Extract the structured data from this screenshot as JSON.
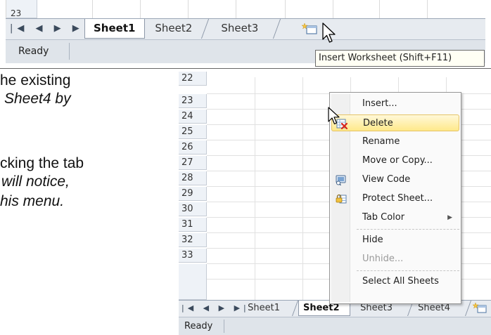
{
  "top_screenshot": {
    "row_number": "23",
    "nav_buttons": "|◀ ◀ ▶ ▶|",
    "tabs": [
      {
        "label": "Sheet1",
        "active": true
      },
      {
        "label": "Sheet2",
        "active": false
      },
      {
        "label": "Sheet3",
        "active": false
      }
    ],
    "insert_sheet_icon": "insert-worksheet-icon",
    "status": "Ready",
    "tooltip": "Insert Worksheet (Shift+F11)"
  },
  "body_text": {
    "line1": "he existing",
    "line2": "Sheet4 by",
    "line3": "cking the tab",
    "line4": "will notice,",
    "line5": "his menu."
  },
  "bottom_screenshot": {
    "row_numbers": [
      "22",
      "23",
      "24",
      "25",
      "26",
      "27",
      "28",
      "29",
      "30",
      "31",
      "32",
      "33"
    ],
    "nav_buttons": "|◀ ◀ ▶ ▶|",
    "tabs": [
      {
        "label": "Sheet1",
        "active": false
      },
      {
        "label": "Sheet2",
        "active": true
      },
      {
        "label": "Sheet3",
        "active": false
      },
      {
        "label": "Sheet4",
        "active": false
      }
    ],
    "status": "Ready",
    "context_menu": {
      "items": [
        {
          "label": "Insert...",
          "icon": "",
          "state": "normal"
        },
        {
          "label": "Delete",
          "icon": "delete-sheet-icon",
          "state": "hover"
        },
        {
          "label": "Rename",
          "icon": "",
          "state": "normal"
        },
        {
          "label": "Move or Copy...",
          "icon": "",
          "state": "normal"
        },
        {
          "label": "View Code",
          "icon": "view-code-icon",
          "state": "normal"
        },
        {
          "label": "Protect Sheet...",
          "icon": "protect-sheet-icon",
          "state": "normal"
        },
        {
          "label": "Tab Color",
          "icon": "",
          "state": "submenu"
        },
        {
          "label": "Hide",
          "icon": "",
          "state": "normal"
        },
        {
          "label": "Unhide...",
          "icon": "",
          "state": "disabled"
        },
        {
          "label": "Select All Sheets",
          "icon": "",
          "state": "normal"
        }
      ]
    }
  },
  "colors": {
    "menu_hover": "#ffe98a",
    "tab_strip": "#e7ebf0",
    "status_bar": "#dfe4ea",
    "tooltip_bg": "#fffff4"
  }
}
